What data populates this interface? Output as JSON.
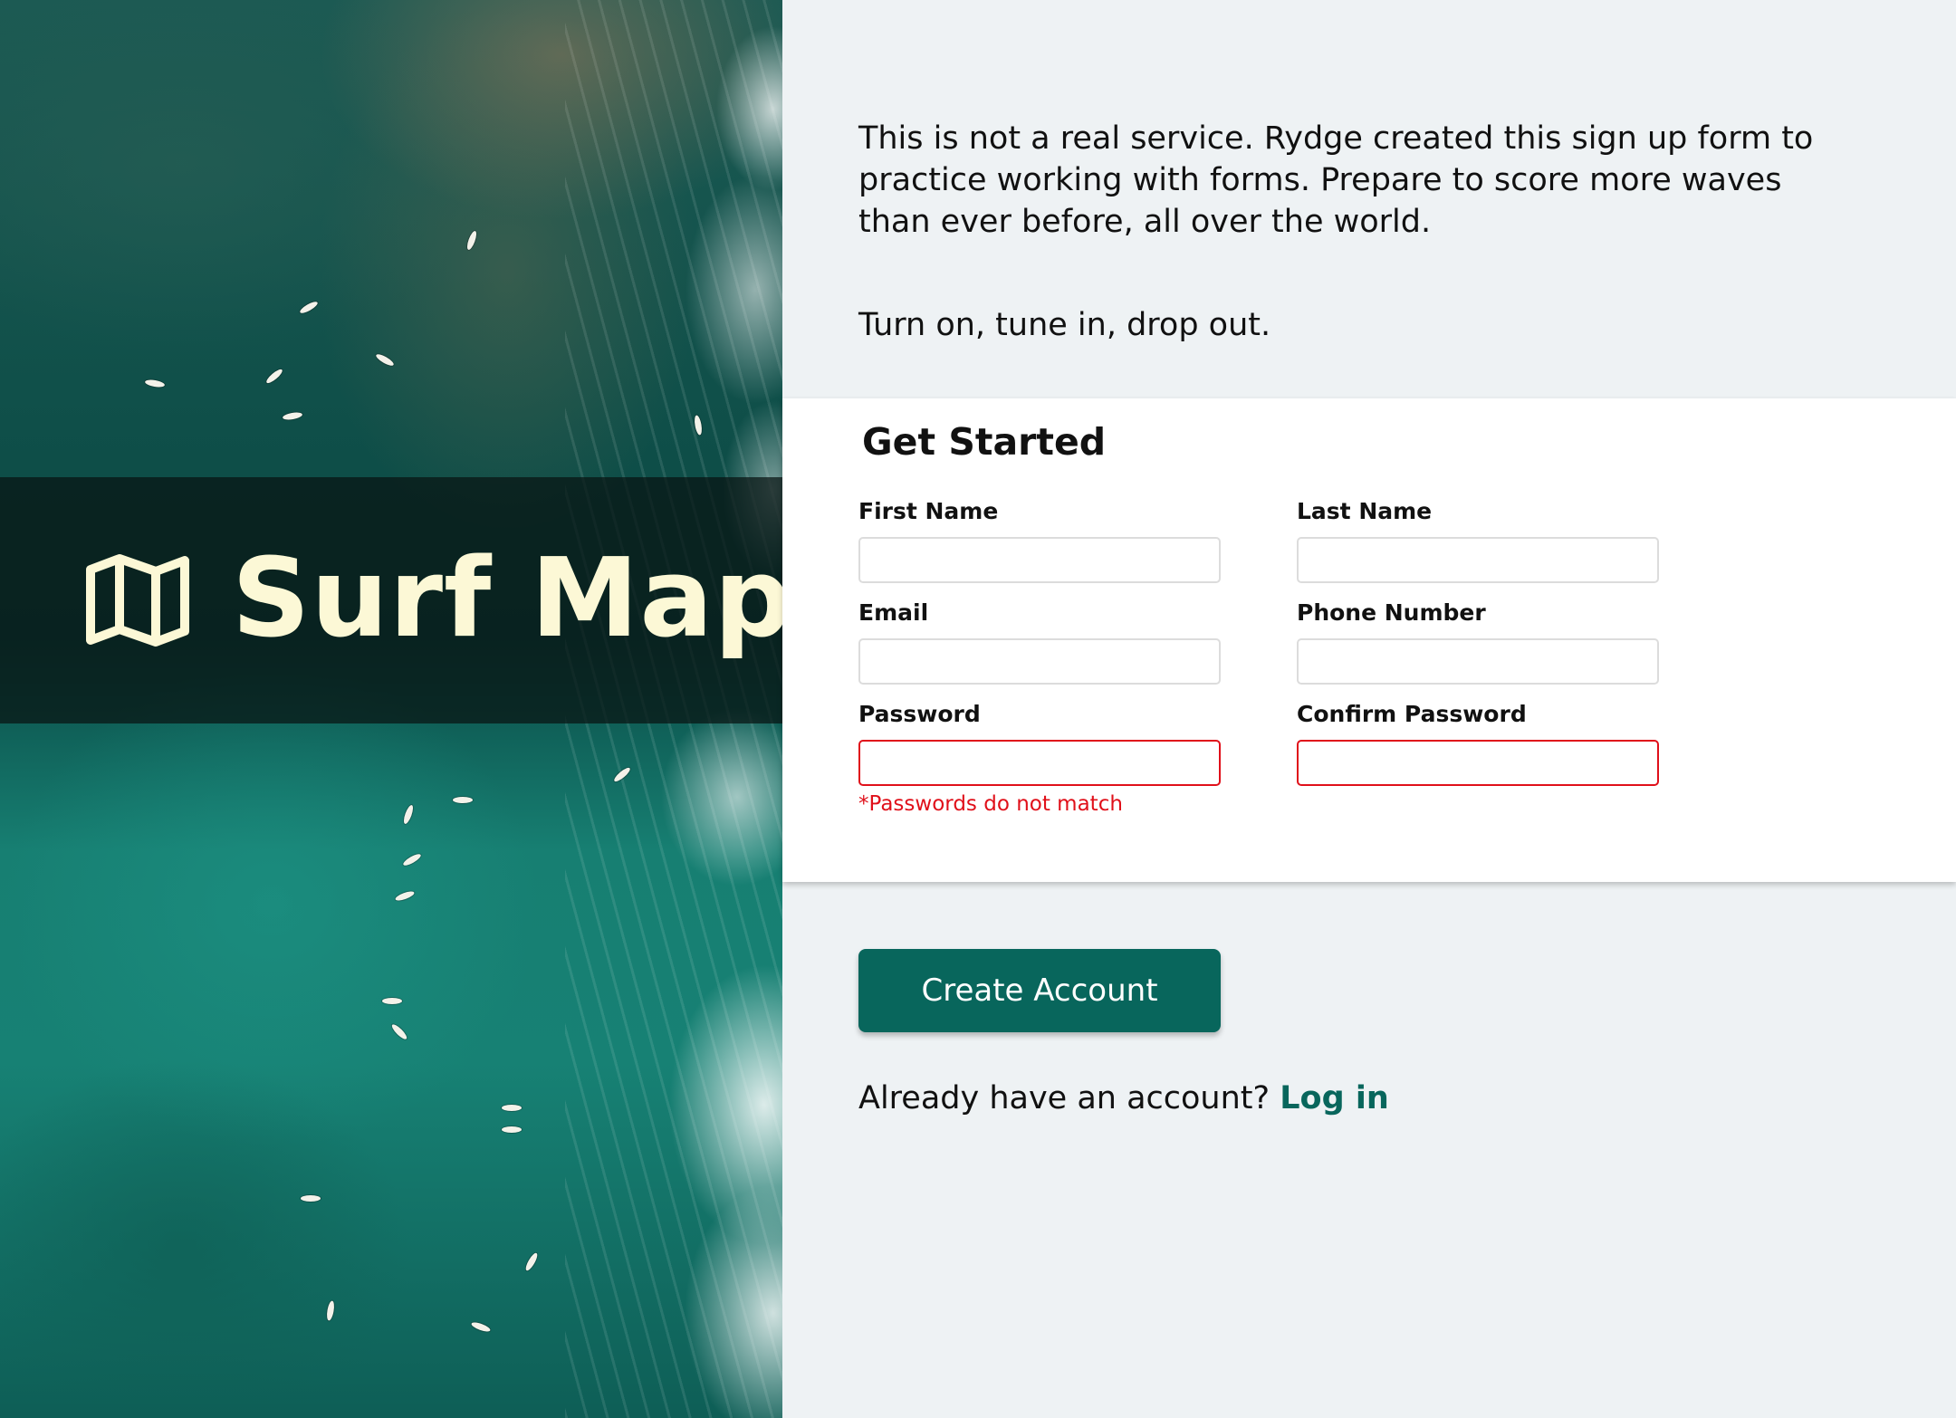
{
  "brand": {
    "title": "Surf Map",
    "icon": "map-icon",
    "title_color": "#fcf8d6"
  },
  "intro": {
    "paragraph": "This is not a real service. Rydge created this sign up form to practice working with forms. Prepare to score more waves than ever before, all over the world.",
    "tagline": "Turn on, tune in, drop out."
  },
  "form": {
    "heading": "Get Started",
    "fields": {
      "first_name": {
        "label": "First Name",
        "value": ""
      },
      "last_name": {
        "label": "Last Name",
        "value": ""
      },
      "email": {
        "label": "Email",
        "value": ""
      },
      "phone": {
        "label": "Phone Number",
        "value": ""
      },
      "password": {
        "label": "Password",
        "value": "",
        "state": "invalid"
      },
      "confirm_password": {
        "label": "Confirm Password",
        "value": "",
        "state": "invalid"
      }
    },
    "error": "*Passwords do not match",
    "error_color": "#e0101a",
    "submit_label": "Create Account"
  },
  "login": {
    "prompt": "Already have an account?",
    "link_label": "Log in"
  },
  "colors": {
    "accent": "#08665c",
    "page_background": "#eef2f4",
    "card_background": "#ffffff"
  }
}
